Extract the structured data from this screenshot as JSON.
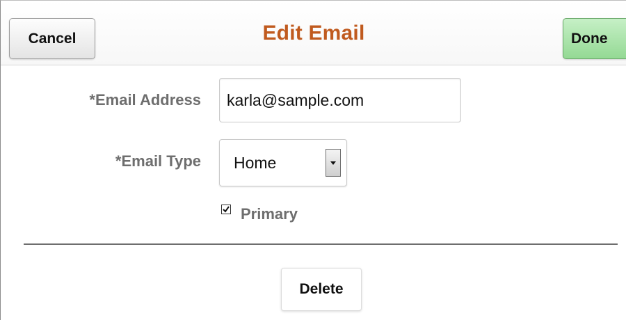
{
  "header": {
    "title": "Edit Email",
    "cancel_label": "Cancel",
    "done_label": "Done"
  },
  "form": {
    "email_address": {
      "label": "*Email Address",
      "value": "karla@sample.com"
    },
    "email_type": {
      "label": "*Email Type",
      "selected": "Home"
    },
    "primary": {
      "label": "Primary",
      "checked": true
    }
  },
  "actions": {
    "delete_label": "Delete"
  },
  "colors": {
    "title": "#c05a1e",
    "done_button": "#94d994",
    "label": "#6e6e6e"
  }
}
